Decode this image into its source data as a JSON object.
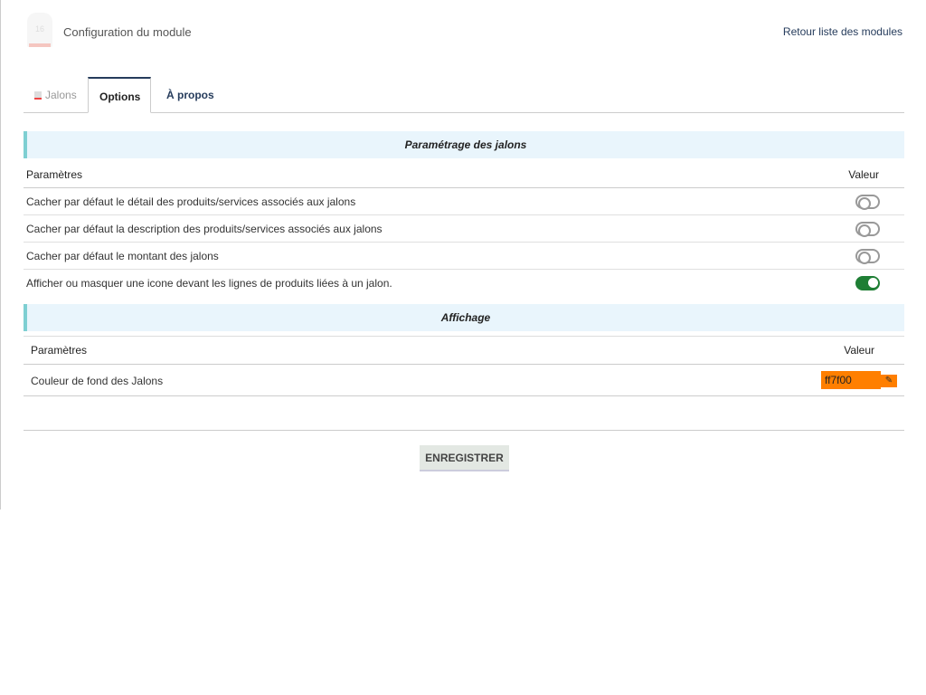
{
  "header": {
    "logo_number": "16",
    "title": "Configuration du module",
    "back_link": "Retour liste des modules"
  },
  "tabs": [
    {
      "label": "Jalons"
    },
    {
      "label": "Options"
    },
    {
      "label": "À propos"
    }
  ],
  "section1": {
    "title": "Paramétrage des jalons",
    "col_param": "Paramètres",
    "col_value": "Valeur",
    "rows": [
      {
        "label": "Cacher par défaut le détail des produits/services associés aux jalons",
        "enabled": false
      },
      {
        "label": "Cacher par défaut la description des produits/services associés aux jalons",
        "enabled": false
      },
      {
        "label": "Cacher par défaut le montant des jalons",
        "enabled": false
      },
      {
        "label": "Afficher ou masquer une icone devant les lignes de produits liées à un jalon.",
        "enabled": true
      }
    ]
  },
  "section2": {
    "title": "Affichage",
    "col_param": "Paramètres",
    "col_value": "Valeur",
    "rows": [
      {
        "label": "Couleur de fond des Jalons",
        "value": "ff7f00",
        "color": "#ff7f00"
      }
    ]
  },
  "save_label": "ENREGISTRER"
}
